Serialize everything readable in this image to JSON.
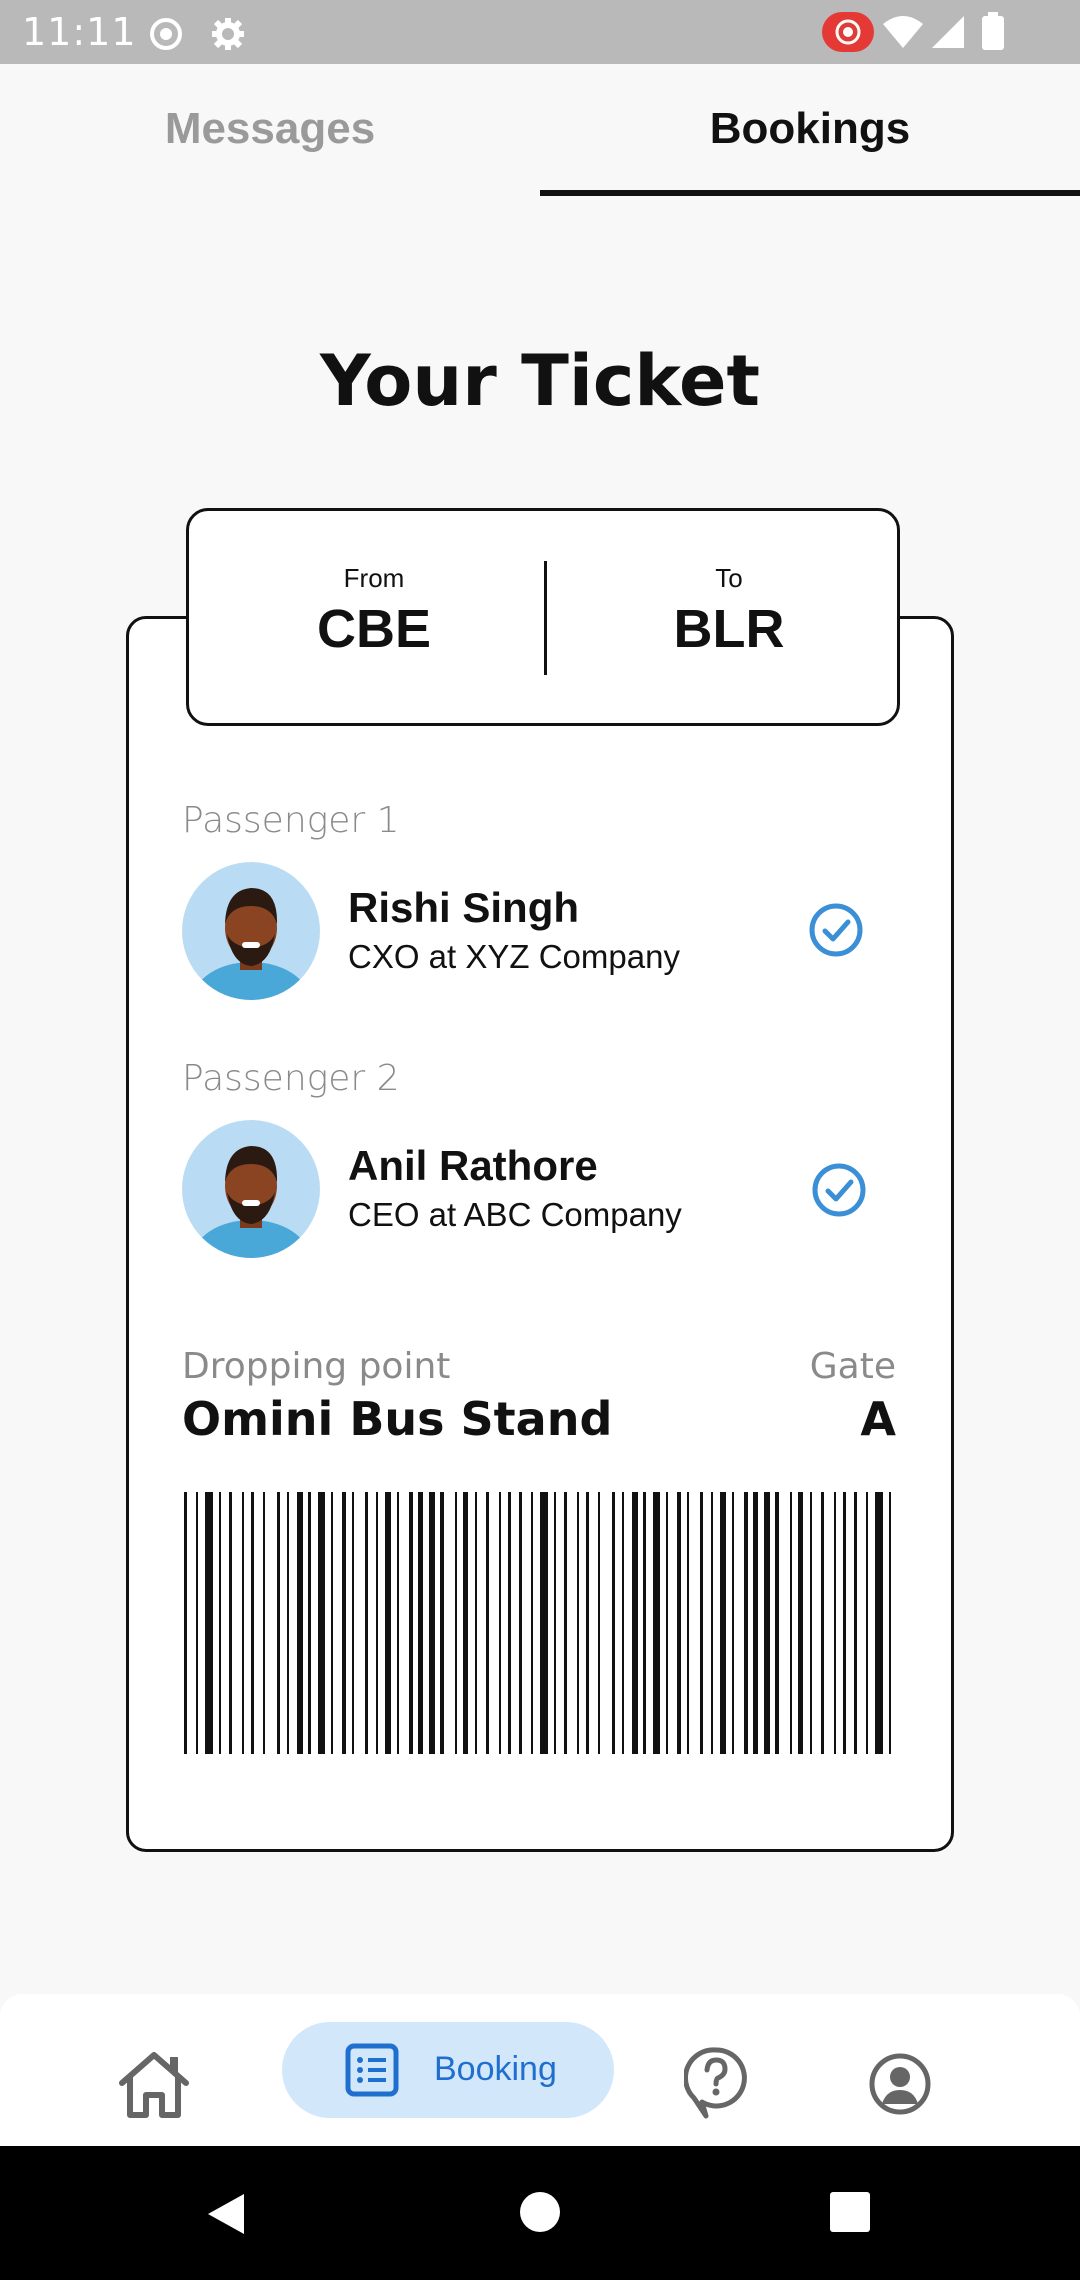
{
  "status_bar": {
    "time": "11:11",
    "icons": [
      "record-icon",
      "settings-icon",
      "screen-record-icon",
      "wifi-icon",
      "signal-icon",
      "battery-icon"
    ]
  },
  "tabs": [
    {
      "label": "Messages",
      "active": false
    },
    {
      "label": "Bookings",
      "active": true
    }
  ],
  "page_title": "Your Ticket",
  "route": {
    "from_label": "From",
    "from_code": "CBE",
    "to_label": "To",
    "to_code": "BLR"
  },
  "passengers": [
    {
      "label": "Passenger 1",
      "name": "Rishi Singh",
      "role": "CXO at XYZ Company",
      "verified": true
    },
    {
      "label": "Passenger 2",
      "name": "Anil Rathore",
      "role": "CEO at ABC Company",
      "verified": true
    }
  ],
  "dropping": {
    "label": "Dropping point",
    "value": "Omini Bus Stand"
  },
  "gate": {
    "label": "Gate",
    "value": "A"
  },
  "bottom_nav": {
    "items": [
      {
        "icon": "home-icon",
        "label": ""
      },
      {
        "icon": "list-icon",
        "label": "Booking",
        "active": true
      },
      {
        "icon": "help-icon",
        "label": ""
      },
      {
        "icon": "profile-icon",
        "label": ""
      }
    ]
  },
  "colors": {
    "accent": "#1f6fcf",
    "accent_bg": "#d3e7fb",
    "check": "#3b8fd6"
  }
}
